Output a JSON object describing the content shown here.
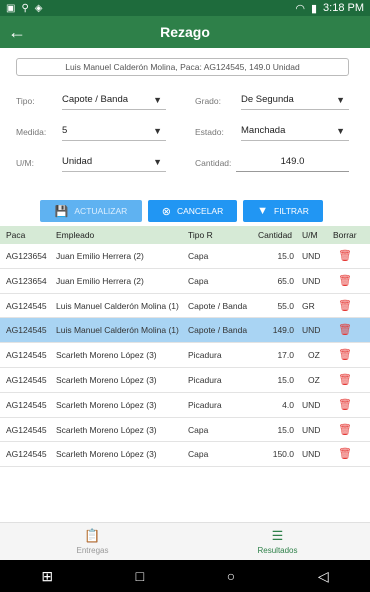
{
  "status": {
    "time": "3:18 PM",
    "icons": [
      "sim-icon",
      "usb-icon",
      "android-icon"
    ]
  },
  "app": {
    "title": "Rezago"
  },
  "summary": "Luis Manuel Calderón Molina, Paca: AG124545, 149.0 Unidad",
  "form": {
    "tipo": {
      "label": "Tipo:",
      "value": "Capote / Banda"
    },
    "grado": {
      "label": "Grado:",
      "value": "De Segunda"
    },
    "medida": {
      "label": "Medida:",
      "value": "5"
    },
    "estado": {
      "label": "Estado:",
      "value": "Manchada"
    },
    "um": {
      "label": "U/M:",
      "value": "Unidad"
    },
    "cantidad": {
      "label": "Cantidad:",
      "value": "149.0"
    }
  },
  "buttons": {
    "actualizar": "ACTUALIZAR",
    "cancelar": "CANCELAR",
    "filtrar": "FILTRAR"
  },
  "table": {
    "headers": {
      "paca": "Paca",
      "empleado": "Empleado",
      "tipo": "Tipo R",
      "cantidad": "Cantidad",
      "um": "U/M",
      "borrar": "Borrar"
    },
    "rows": [
      {
        "paca": "AG123654",
        "empleado": "Juan Emilio Herrera (2)",
        "tipo": "Capa",
        "cantidad": "15.0",
        "um": "UND"
      },
      {
        "paca": "AG123654",
        "empleado": "Juan Emilio Herrera (2)",
        "tipo": "Capa",
        "cantidad": "65.0",
        "um": "UND"
      },
      {
        "paca": "AG124545",
        "empleado": "Luis Manuel Calderón Molina (1)",
        "tipo": "Capote / Banda",
        "cantidad": "55.0",
        "um": "GR"
      },
      {
        "paca": "AG124545",
        "empleado": "Luis Manuel Calderón Molina (1)",
        "tipo": "Capote / Banda",
        "cantidad": "149.0",
        "um": "UND"
      },
      {
        "paca": "AG124545",
        "empleado": "Scarleth Moreno López (3)",
        "tipo": "Picadura",
        "cantidad": "17.0",
        "um": "OZ"
      },
      {
        "paca": "AG124545",
        "empleado": "Scarleth Moreno López (3)",
        "tipo": "Picadura",
        "cantidad": "15.0",
        "um": "OZ"
      },
      {
        "paca": "AG124545",
        "empleado": "Scarleth Moreno López (3)",
        "tipo": "Picadura",
        "cantidad": "4.0",
        "um": "UND"
      },
      {
        "paca": "AG124545",
        "empleado": "Scarleth Moreno López (3)",
        "tipo": "Capa",
        "cantidad": "15.0",
        "um": "UND"
      },
      {
        "paca": "AG124545",
        "empleado": "Scarleth Moreno López (3)",
        "tipo": "Capa",
        "cantidad": "150.0",
        "um": "UND"
      }
    ],
    "selected_index": 3
  },
  "bottom_nav": {
    "entregas": "Entregas",
    "resultados": "Resultados",
    "active": "resultados"
  },
  "colors": {
    "primary": "#2e8049",
    "status": "#1e6b3c",
    "button": "#2196f3",
    "delete": "#e53935",
    "selected_row": "#a9d4f3",
    "header_bg": "#d6ead6"
  }
}
